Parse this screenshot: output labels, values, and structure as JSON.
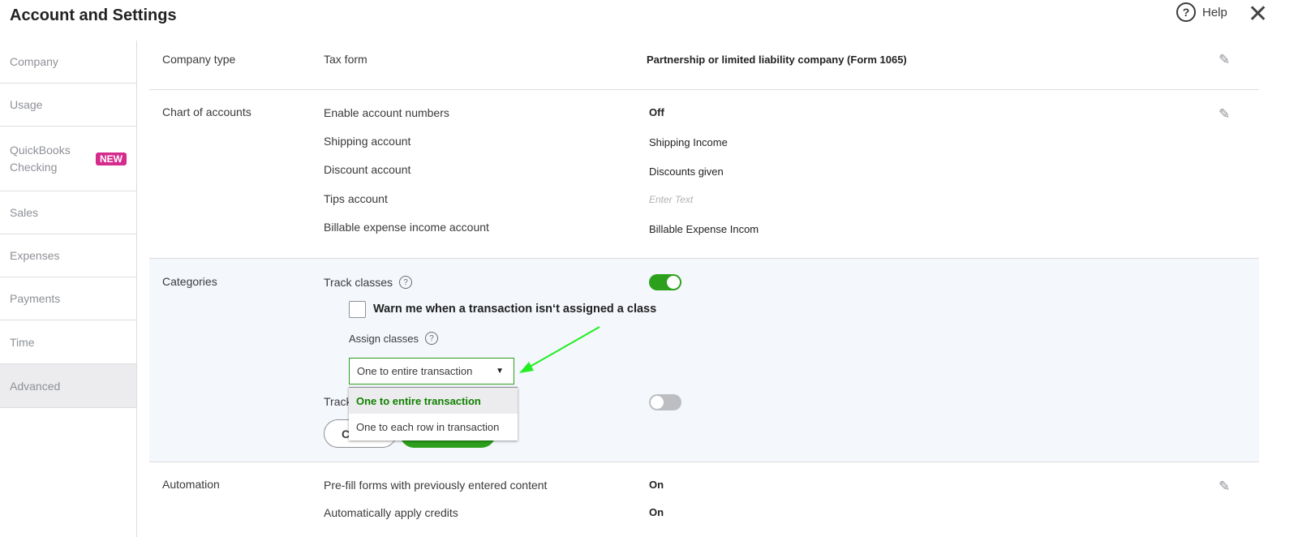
{
  "header": {
    "title": "Account and Settings",
    "help_label": "Help",
    "help_icon": "?",
    "close_icon": "✕"
  },
  "sidebar": {
    "items": [
      {
        "label": "Company"
      },
      {
        "label": "Usage"
      },
      {
        "label": "QuickBooks Checking",
        "badge": "NEW"
      },
      {
        "label": "Sales"
      },
      {
        "label": "Expenses"
      },
      {
        "label": "Payments"
      },
      {
        "label": "Time"
      },
      {
        "label": "Advanced",
        "active": true
      }
    ]
  },
  "sections": {
    "company_type": {
      "title": "Company type",
      "field": "Tax form",
      "value": "Partnership or limited liability company (Form 1065)"
    },
    "chart_of_accounts": {
      "title": "Chart of accounts",
      "rows": [
        {
          "label": "Enable account numbers",
          "value": "Off"
        },
        {
          "label": "Shipping account",
          "value": "Shipping Income"
        },
        {
          "label": "Discount account",
          "value": "Discounts given"
        },
        {
          "label": "Tips account",
          "placeholder": "Enter Text"
        },
        {
          "label": "Billable expense income account",
          "value": "Billable Expense Incom"
        }
      ]
    },
    "categories": {
      "title": "Categories",
      "track_classes": "Track classes",
      "track_classes_on": true,
      "warn_label": "Warn me when a transaction isn‘t assigned a class",
      "warn_checked": false,
      "assign_label": "Assign classes",
      "assign_value": "One to entire transaction",
      "options": [
        "One to entire transaction",
        "One to each row in transaction"
      ],
      "track_partial": "Track",
      "track_second_on": false,
      "cancel_label": "Cancel"
    },
    "automation": {
      "title": "Automation",
      "rows": [
        {
          "label": "Pre-fill forms with previously entered content",
          "value": "On"
        },
        {
          "label": "Automatically apply credits",
          "value": "On"
        }
      ]
    }
  },
  "colors": {
    "accent": "#2ca01c",
    "badge": "#d52b8c",
    "annotation_arrow": "#22ee22",
    "category_bg": "#f4f7fc"
  }
}
